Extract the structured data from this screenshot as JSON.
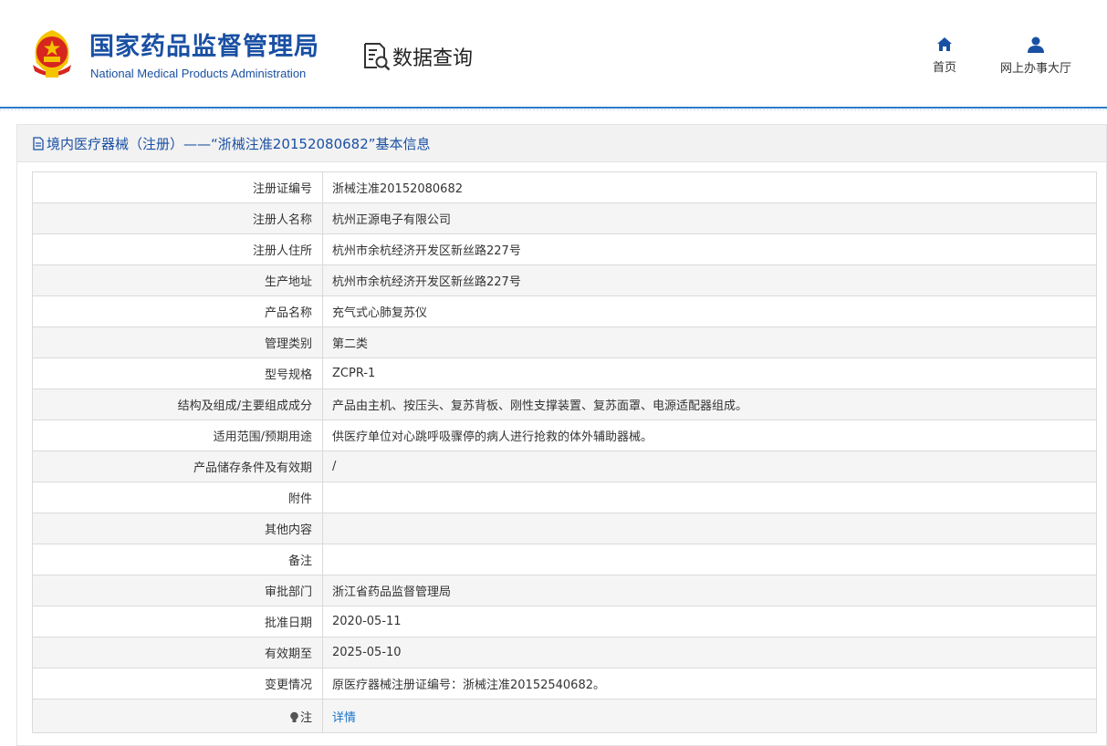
{
  "brand": {
    "name_cn": "国家药品监督管理局",
    "name_en": "National Medical Products Administration"
  },
  "module": {
    "label": "数据查询",
    "icon": "document-search-icon"
  },
  "nav": {
    "home_label": "首页",
    "home_icon": "home-icon",
    "hall_label": "网上办事大厅",
    "hall_icon": "user-icon"
  },
  "panel": {
    "title": "境内医疗器械（注册）——“浙械注准20152080682”基本信息",
    "title_icon": "document-icon"
  },
  "record": {
    "rows": [
      {
        "label": "注册证编号",
        "value": "浙械注准20152080682"
      },
      {
        "label": "注册人名称",
        "value": "杭州正源电子有限公司"
      },
      {
        "label": "注册人住所",
        "value": "杭州市余杭经济开发区新丝路227号"
      },
      {
        "label": "生产地址",
        "value": "杭州市余杭经济开发区新丝路227号"
      },
      {
        "label": "产品名称",
        "value": "充气式心肺复苏仪"
      },
      {
        "label": "管理类别",
        "value": "第二类"
      },
      {
        "label": "型号规格",
        "value": "ZCPR-1"
      },
      {
        "label": "结构及组成/主要组成成分",
        "value": "产品由主机、按压头、复苏背板、刚性支撑装置、复苏面罩、电源适配器组成。"
      },
      {
        "label": "适用范围/预期用途",
        "value": "供医疗单位对心跳呼吸骤停的病人进行抢救的体外辅助器械。"
      },
      {
        "label": "产品储存条件及有效期",
        "value": "/"
      },
      {
        "label": "附件",
        "value": ""
      },
      {
        "label": "其他内容",
        "value": ""
      },
      {
        "label": "备注",
        "value": ""
      },
      {
        "label": "审批部门",
        "value": "浙江省药品监督管理局"
      },
      {
        "label": "批准日期",
        "value": "2020-05-11"
      },
      {
        "label": "有效期至",
        "value": "2025-05-10"
      },
      {
        "label": "变更情况",
        "value": "原医疗器械注册证编号：浙械注准20152540682。"
      }
    ],
    "note": {
      "label": "注",
      "icon": "lightbulb-icon",
      "link_text": "详情"
    }
  },
  "colors": {
    "brand_blue": "#1a50a3",
    "link_blue": "#1a73c9",
    "emblem_red": "#d7261e",
    "emblem_gold": "#f5c400"
  }
}
